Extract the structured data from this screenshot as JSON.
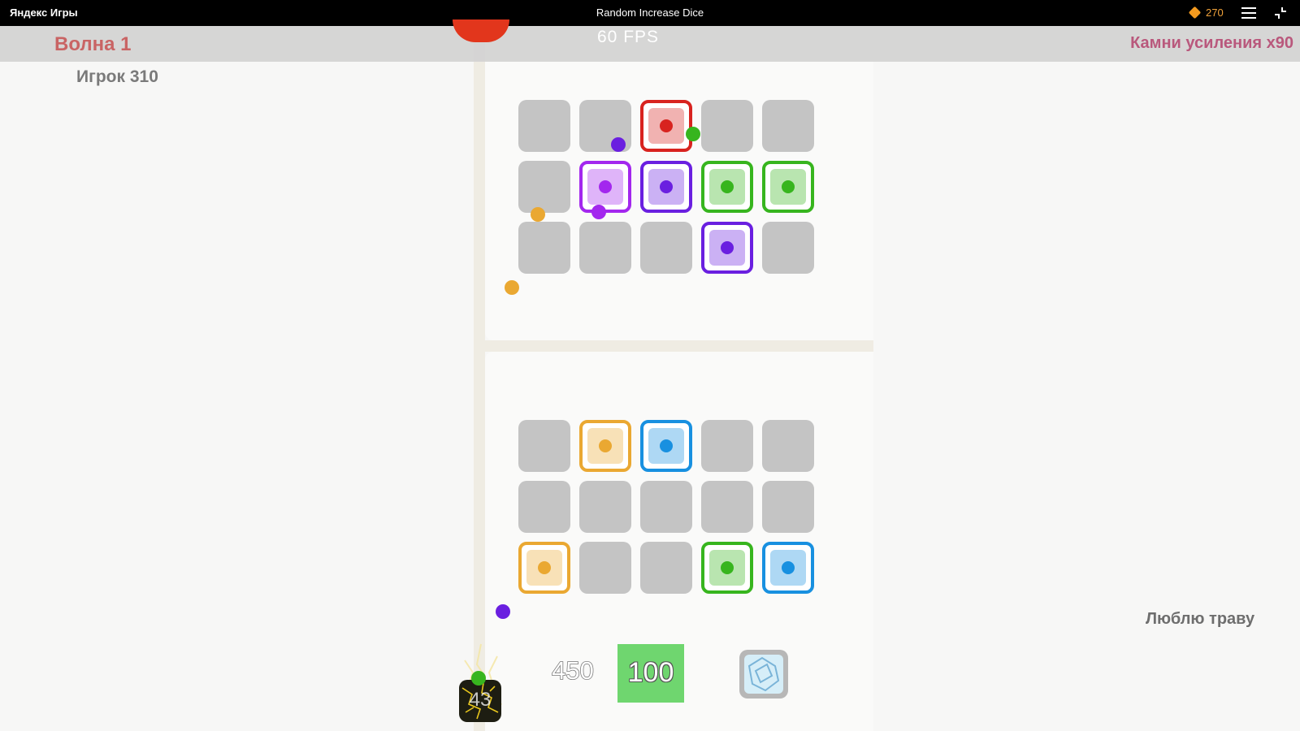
{
  "topbar": {
    "brand": "Яндекс Игры",
    "title": "Random Increase Dice",
    "coins": "270"
  },
  "hud": {
    "wave": "Волна 1",
    "fps": "60 FPS",
    "stones": "Камни усиления x90",
    "player": "Игрок 310",
    "grass_label": "Люблю траву"
  },
  "colors": {
    "red": "#d8231f",
    "purple": "#a327ee",
    "violet": "#6a1fe0",
    "green": "#37b51e",
    "orange": "#eaa832",
    "blue": "#1890e0",
    "grey_slot": "#c4c4c4"
  },
  "opponent_board": {
    "cells": [
      {
        "die": null
      },
      {
        "die": null
      },
      {
        "die": "red"
      },
      {
        "die": null
      },
      {
        "die": null
      },
      {
        "die": null
      },
      {
        "die": "purple"
      },
      {
        "die": "violet"
      },
      {
        "die": "green"
      },
      {
        "die": "green"
      },
      {
        "die": null
      },
      {
        "die": null
      },
      {
        "die": null
      },
      {
        "die": "violet"
      },
      {
        "die": null
      }
    ]
  },
  "player_board": {
    "cells": [
      {
        "die": null
      },
      {
        "die": "orange"
      },
      {
        "die": "blue"
      },
      {
        "die": null
      },
      {
        "die": null
      },
      {
        "die": null
      },
      {
        "die": null
      },
      {
        "die": null
      },
      {
        "die": null
      },
      {
        "die": null
      },
      {
        "die": "orange"
      },
      {
        "die": null
      },
      {
        "die": null
      },
      {
        "die": "green"
      },
      {
        "die": "blue"
      }
    ]
  },
  "bottom": {
    "ability_count": "43",
    "spawn_cost": "450",
    "spawn_button": "100",
    "upgrade_icon": "dice-upgrade-icon"
  }
}
